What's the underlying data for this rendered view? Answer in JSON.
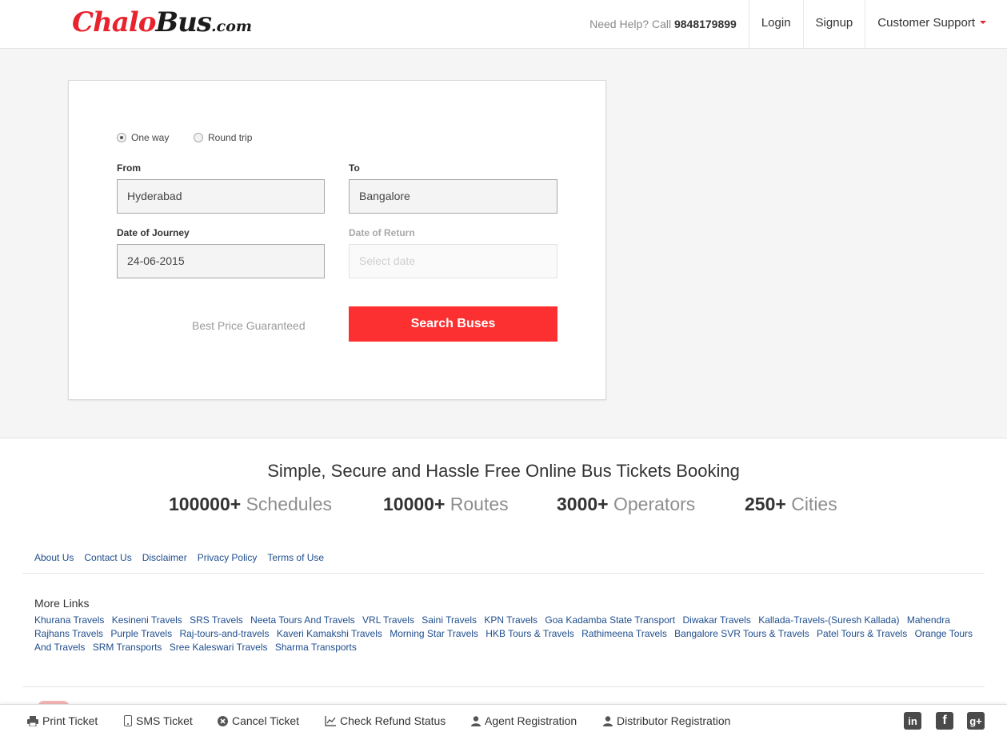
{
  "header": {
    "logo": {
      "chalo": "Chalo",
      "bus": "Bus",
      "dotcom": ".com"
    },
    "help_prefix": "Need Help? Call",
    "help_phone": "9848179899",
    "login": "Login",
    "signup": "Signup",
    "support": "Customer Support"
  },
  "search": {
    "one_way": "One way",
    "round_trip": "Round trip",
    "selected_trip": "One way",
    "from_label": "From",
    "from_value": "Hyderabad",
    "to_label": "To",
    "to_value": "Bangalore",
    "journey_label": "Date of Journey",
    "journey_value": "24-06-2015",
    "return_label": "Date of Return",
    "return_placeholder": "Select date",
    "best_price": "Best Price Guaranteed",
    "search_button": "Search Buses"
  },
  "stats": {
    "tagline": "Simple, Secure and Hassle Free Online Bus Tickets Booking",
    "items": [
      {
        "num": "100000+",
        "text": "Schedules"
      },
      {
        "num": "10000+",
        "text": "Routes"
      },
      {
        "num": "3000+",
        "text": "Operators"
      },
      {
        "num": "250+",
        "text": "Cities"
      }
    ]
  },
  "footer": {
    "links": [
      "About Us",
      "Contact Us",
      "Disclaimer",
      "Privacy Policy",
      "Terms of Use"
    ],
    "more_title": "More Links",
    "more_links": [
      "Khurana Travels",
      "Kesineni Travels",
      "SRS Travels",
      "Neeta Tours And Travels",
      "VRL Travels",
      "Saini Travels",
      "KPN Travels",
      "Goa Kadamba State Transport",
      "Diwakar Travels",
      "Kallada-Travels-(Suresh Kallada)",
      "Mahendra Rajhans Travels",
      "Purple Travels",
      "Raj-tours-and-travels",
      "Kaveri Kamakshi Travels",
      "Morning Star Travels",
      "HKB Tours & Travels",
      "Rathimeena Travels",
      "Bangalore SVR Tours & Travels",
      "Patel Tours & Travels",
      "Orange Tours And Travels",
      "SRM Transports",
      "Sree Kaleswari Travels",
      "Sharma Transports"
    ]
  },
  "bottombar": {
    "print": "Print Ticket",
    "sms": "SMS Ticket",
    "cancel": "Cancel Ticket",
    "refund": "Check Refund Status",
    "agent": "Agent Registration",
    "distributor": "Distributor Registration",
    "social": {
      "linkedin": "in",
      "facebook": "f",
      "gplus": "g+"
    }
  },
  "colors": {
    "brand_red": "#e8232e",
    "button_red": "#fc3030",
    "link_blue": "#1e4d8c"
  }
}
